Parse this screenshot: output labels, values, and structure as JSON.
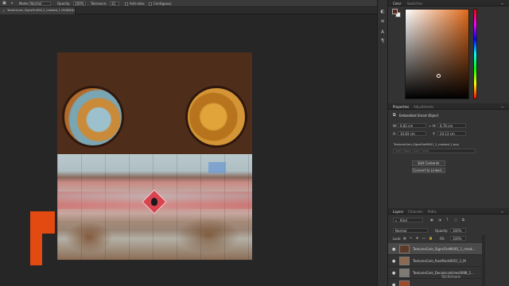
{
  "options_bar": {
    "mode_label": "Mode:",
    "mode_value": "Normal",
    "opacity_label": "Opacity:",
    "opacity_value": "100%",
    "tolerance_label": "Tolerance:",
    "tolerance_value": "32",
    "antialias_label": "Anti-alias",
    "contiguous_label": "Contiguous"
  },
  "document": {
    "tab_title": "Texturecom_SignsFireMill_1_masked_1 (RGB/8#)"
  },
  "colors": {
    "foreground": "#5a2a1a",
    "background": "#eeeeee",
    "picker_hue": "#e06a1a"
  },
  "color_panel": {
    "tabs": [
      "Color",
      "Swatches"
    ]
  },
  "properties_panel": {
    "tabs": [
      "Properties",
      "Adjustments"
    ],
    "object_type": "Embedded Smart Object",
    "w_label": "W:",
    "w_value": "6.82 cm",
    "h_label": "H:",
    "h_value": "6.76 cm",
    "x_label": "X:",
    "x_value": "10.83 cm",
    "y_label": "Y:",
    "y_value": "24.13 cm",
    "file_name": "TexturesCom_SignsFireMill01_1_masked_1.png",
    "layer_comp_placeholder": "Don't Apply Layer Comp",
    "edit_contents_label": "Edit Contents",
    "convert_label": "Convert to Linked..."
  },
  "layers_panel": {
    "tabs": [
      "Layers",
      "Channels",
      "Paths"
    ],
    "kind_label": "Kind",
    "blend_mode": "Normal",
    "opacity_label": "Opacity:",
    "opacity_value": "100%",
    "lock_label": "Lock:",
    "fill_label": "Fill:",
    "fill_value": "100%",
    "layers": [
      {
        "name": "TexturesCom_SignsFireMill01_1_mask...",
        "selected": true,
        "thumb": "#5b3a28"
      },
      {
        "name": "TexturesCom_RustPaint0051_1_M",
        "selected": false,
        "thumb": "#8a6a52"
      },
      {
        "name": "TexturesCom_Decalscratches0098_1...",
        "selected": false,
        "thumb": "#7e7a74"
      },
      {
        "name": "",
        "selected": false,
        "thumb": "#9b4a2a"
      }
    ]
  },
  "watermark": {
    "text": "Skillshare"
  }
}
